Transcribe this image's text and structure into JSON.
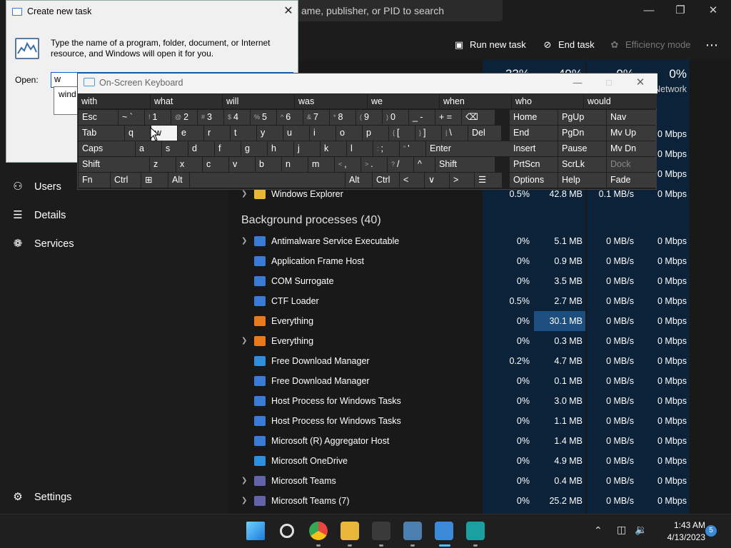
{
  "task_manager": {
    "search_placeholder": "ame, publisher, or PID to search",
    "commands": {
      "run_new_task": "Run new task",
      "end_task": "End task",
      "efficiency_mode": "Efficiency mode",
      "more": "⋯"
    },
    "columns": {
      "cpu_pct": "33%",
      "mem_pct": "49%",
      "disk_pct": "0%",
      "net_pct": "0%",
      "net_label": "Network"
    },
    "nav": [
      {
        "label": "Users",
        "icon": "users-icon"
      },
      {
        "label": "Details",
        "icon": "details-icon"
      },
      {
        "label": "Services",
        "icon": "services-icon"
      }
    ],
    "settings_label": "Settings",
    "apps_partial_rows": [
      {
        "net": "0 Mbps"
      },
      {
        "net": "0 Mbps"
      },
      {
        "net": "0 Mbps"
      }
    ],
    "app_row": {
      "name": "Windows Explorer",
      "cpu": "0.5%",
      "memory": "42.8 MB",
      "disk": "0.1 MB/s",
      "network": "0 Mbps"
    },
    "background_header": "Background processes (40)",
    "processes": [
      {
        "name": "Antimalware Service Executable",
        "cpu": "0%",
        "memory": "5.1 MB",
        "disk": "0 MB/s",
        "network": "0 Mbps",
        "expand": true,
        "color": "#3a7bd5"
      },
      {
        "name": "Application Frame Host",
        "cpu": "0%",
        "memory": "0.9 MB",
        "disk": "0 MB/s",
        "network": "0 Mbps",
        "expand": false,
        "color": "#3a7bd5"
      },
      {
        "name": "COM Surrogate",
        "cpu": "0%",
        "memory": "3.5 MB",
        "disk": "0 MB/s",
        "network": "0 Mbps",
        "expand": false,
        "color": "#3a7bd5"
      },
      {
        "name": "CTF Loader",
        "cpu": "0.5%",
        "memory": "2.7 MB",
        "disk": "0 MB/s",
        "network": "0 Mbps",
        "expand": false,
        "color": "#3a7bd5"
      },
      {
        "name": "Everything",
        "cpu": "0%",
        "memory": "30.1 MB",
        "disk": "0 MB/s",
        "network": "0 Mbps",
        "expand": false,
        "color": "#e87a1d",
        "mem_highlight": true
      },
      {
        "name": "Everything",
        "cpu": "0%",
        "memory": "0.3 MB",
        "disk": "0 MB/s",
        "network": "0 Mbps",
        "expand": true,
        "color": "#e87a1d"
      },
      {
        "name": "Free Download Manager",
        "cpu": "0.2%",
        "memory": "4.7 MB",
        "disk": "0 MB/s",
        "network": "0 Mbps",
        "expand": false,
        "color": "#2f8fdc"
      },
      {
        "name": "Free Download Manager",
        "cpu": "0%",
        "memory": "0.1 MB",
        "disk": "0 MB/s",
        "network": "0 Mbps",
        "expand": false,
        "color": "#3a7bd5"
      },
      {
        "name": "Host Process for Windows Tasks",
        "cpu": "0%",
        "memory": "3.0 MB",
        "disk": "0 MB/s",
        "network": "0 Mbps",
        "expand": false,
        "color": "#3a7bd5"
      },
      {
        "name": "Host Process for Windows Tasks",
        "cpu": "0%",
        "memory": "1.1 MB",
        "disk": "0 MB/s",
        "network": "0 Mbps",
        "expand": false,
        "color": "#3a7bd5"
      },
      {
        "name": "Microsoft (R) Aggregator Host",
        "cpu": "0%",
        "memory": "1.4 MB",
        "disk": "0 MB/s",
        "network": "0 Mbps",
        "expand": false,
        "color": "#3a7bd5"
      },
      {
        "name": "Microsoft OneDrive",
        "cpu": "0%",
        "memory": "4.9 MB",
        "disk": "0 MB/s",
        "network": "0 Mbps",
        "expand": false,
        "color": "#2f8fdc"
      },
      {
        "name": "Microsoft Teams",
        "cpu": "0%",
        "memory": "0.4 MB",
        "disk": "0 MB/s",
        "network": "0 Mbps",
        "expand": true,
        "color": "#6264a7"
      },
      {
        "name": "Microsoft Teams (7)",
        "cpu": "0%",
        "memory": "25.2 MB",
        "disk": "0 MB/s",
        "network": "0 Mbps",
        "expand": true,
        "color": "#6264a7"
      }
    ]
  },
  "create_task_dialog": {
    "title": "Create new task",
    "description": "Type the name of a program, folder, document, or Internet resource, and Windows will open it for you.",
    "open_label": "Open:",
    "input_value": "w",
    "suggestion": "wind"
  },
  "osk": {
    "title": "On-Screen Keyboard",
    "predictions": [
      "with",
      "what",
      "will",
      "was",
      "we",
      "when",
      "who",
      "would"
    ],
    "rows": [
      [
        {
          "k": "Esc"
        },
        {
          "k": "~ `"
        },
        {
          "s": "!",
          "k": "1"
        },
        {
          "s": "@",
          "k": "2"
        },
        {
          "s": "#",
          "k": "3"
        },
        {
          "s": "$",
          "k": "4"
        },
        {
          "s": "%",
          "k": "5"
        },
        {
          "s": "^",
          "k": "6"
        },
        {
          "s": "&",
          "k": "7"
        },
        {
          "s": "*",
          "k": "8"
        },
        {
          "s": "(",
          "k": "9"
        },
        {
          "s": ")",
          "k": "0"
        },
        {
          "k": "_ -"
        },
        {
          "k": "+ ="
        },
        {
          "k": "⌫"
        }
      ],
      [
        {
          "k": "Tab"
        },
        {
          "k": "q"
        },
        {
          "k": "w"
        },
        {
          "k": "e"
        },
        {
          "k": "r"
        },
        {
          "k": "t"
        },
        {
          "k": "y"
        },
        {
          "k": "u"
        },
        {
          "k": "i"
        },
        {
          "k": "o"
        },
        {
          "k": "p"
        },
        {
          "s": "{",
          "k": "["
        },
        {
          "s": "}",
          "k": "]"
        },
        {
          "s": "|",
          "k": "\\"
        },
        {
          "k": "Del"
        }
      ],
      [
        {
          "k": "Caps"
        },
        {
          "k": "a"
        },
        {
          "k": "s"
        },
        {
          "k": "d"
        },
        {
          "k": "f"
        },
        {
          "k": "g"
        },
        {
          "k": "h"
        },
        {
          "k": "j"
        },
        {
          "k": "k"
        },
        {
          "k": "l"
        },
        {
          "s": ":",
          "k": ";"
        },
        {
          "s": "\"",
          "k": "'"
        },
        {
          "k": "Enter"
        }
      ],
      [
        {
          "k": "Shift"
        },
        {
          "k": "z"
        },
        {
          "k": "x"
        },
        {
          "k": "c"
        },
        {
          "k": "v"
        },
        {
          "k": "b"
        },
        {
          "k": "n"
        },
        {
          "k": "m"
        },
        {
          "s": "<",
          "k": ","
        },
        {
          "s": ">",
          "k": "."
        },
        {
          "s": "?",
          "k": "/"
        },
        {
          "k": "^"
        },
        {
          "k": "Shift"
        }
      ],
      [
        {
          "k": "Fn"
        },
        {
          "k": "Ctrl"
        },
        {
          "k": "⊞"
        },
        {
          "k": "Alt"
        },
        {
          "k": ""
        },
        {
          "k": "Alt"
        },
        {
          "k": "Ctrl"
        },
        {
          "k": "<"
        },
        {
          "k": "∨"
        },
        {
          "k": ">"
        },
        {
          "k": "☰"
        }
      ]
    ],
    "right_keys": [
      [
        "Home",
        "PgUp",
        "Nav"
      ],
      [
        "End",
        "PgDn",
        "Mv Up"
      ],
      [
        "Insert",
        "Pause",
        "Mv Dn"
      ],
      [
        "PrtScn",
        "ScrLk",
        "Dock"
      ],
      [
        "Options",
        "Help",
        "Fade"
      ]
    ]
  },
  "taskbar": {
    "time": "1:43 AM",
    "date": "4/13/2023",
    "notifications": "5",
    "icons": [
      "start-icon",
      "search-icon",
      "chrome-icon",
      "file-explorer-icon",
      "terminal-icon",
      "resource-monitor-icon",
      "task-manager-icon",
      "remote-desktop-icon"
    ]
  }
}
